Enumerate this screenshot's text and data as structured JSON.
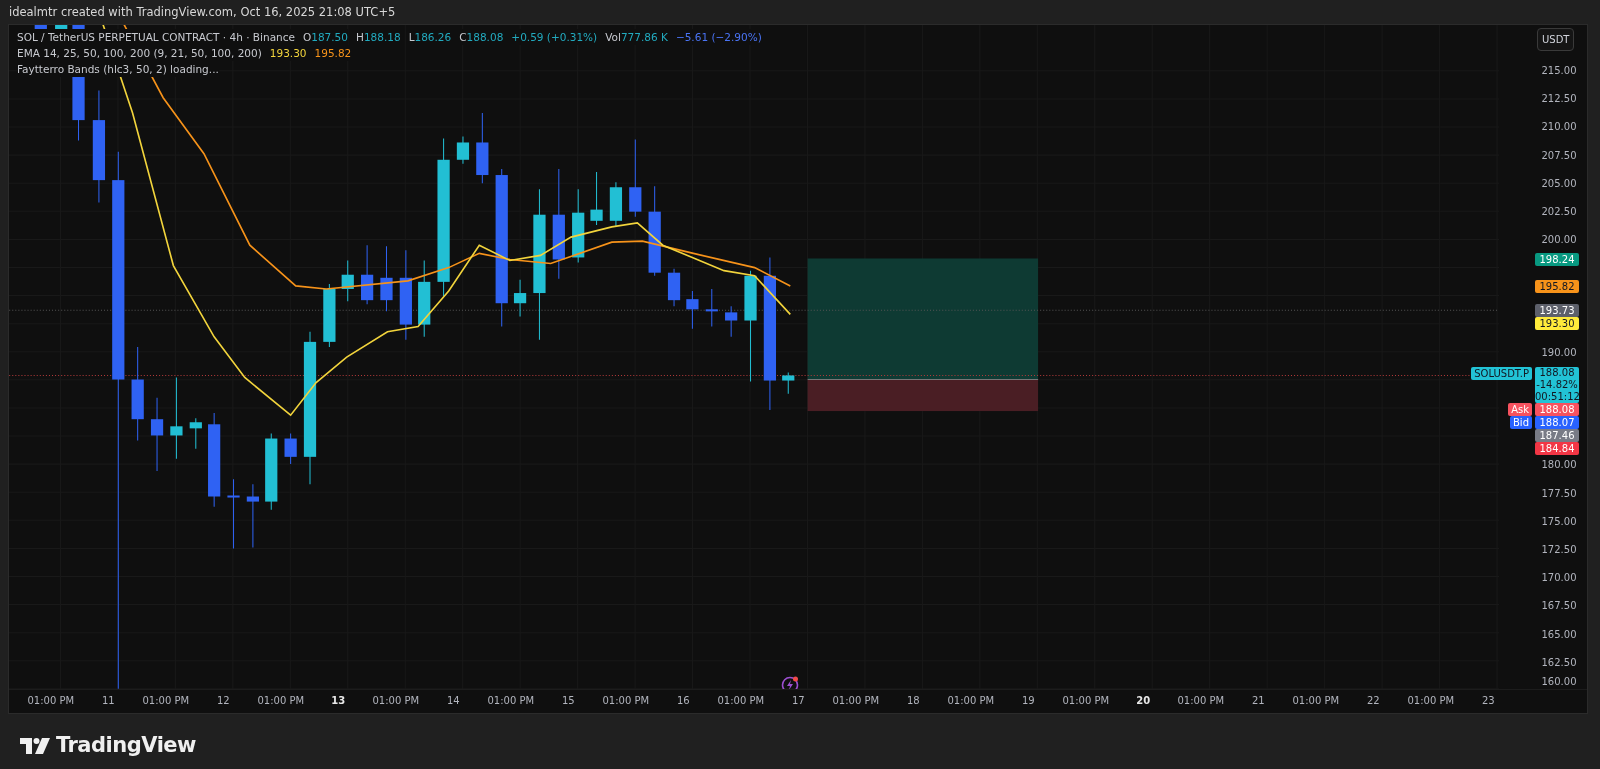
{
  "header": {
    "text": "idealmtr created with TradingView.com, Oct 16, 2025 21:08 UTC+5"
  },
  "legend": {
    "title": "SOL / TetherUS PERPETUAL CONTRACT · 4h · Binance",
    "ohlc": [
      {
        "label": "O",
        "value": "187.50"
      },
      {
        "label": "H",
        "value": "188.18"
      },
      {
        "label": "L",
        "value": "186.26"
      },
      {
        "label": "C",
        "value": "188.08"
      }
    ],
    "change": "+0.59 (+0.31%)",
    "volume": {
      "label": "Vol",
      "value": "777.86 K",
      "change": "−5.61 (−2.90%)"
    },
    "indicators": [
      {
        "name": "EMA 14, 25, 50, 100, 200 (9, 21, 50, 100, 200)",
        "values": [
          {
            "text": "193.30",
            "color": "#f2d43c"
          },
          {
            "text": "195.82",
            "color": "#f7931a"
          }
        ]
      },
      {
        "name": "Faytterro Bands (hlc3, 50, 2) loading..."
      }
    ]
  },
  "price_axis": {
    "currency": "USDT",
    "ticks": [
      "215.00",
      "212.50",
      "210.00",
      "207.50",
      "205.00",
      "202.50",
      "200.00",
      "190.00",
      "180.00",
      "177.50",
      "175.00",
      "172.50",
      "170.00",
      "167.50",
      "165.00",
      "162.50",
      "160.00"
    ],
    "tags": [
      {
        "kind": "price",
        "text": "198.24",
        "color": "#089981"
      },
      {
        "kind": "price",
        "text": "195.82",
        "color": "#f7931a"
      },
      {
        "kind": "price",
        "text": "193.73",
        "color": "#5d606b"
      },
      {
        "kind": "price",
        "text": "193.30",
        "color": "#ffeb3b"
      },
      {
        "kind": "last",
        "symbol": "SOLUSDT.P",
        "text": "188.08",
        "change": "-14.82%",
        "countdown": "00:51:12",
        "color": "#22c3d6"
      },
      {
        "kind": "quote",
        "label": "Ask",
        "text": "188.08",
        "color": "#f7525f"
      },
      {
        "kind": "quote",
        "label": "Bid",
        "text": "188.07",
        "color": "#2962ff"
      },
      {
        "kind": "price",
        "text": "187.46",
        "color": "#787b86"
      },
      {
        "kind": "price",
        "text": "184.84",
        "color": "#f23645"
      }
    ]
  },
  "time_axis": [
    {
      "text": "01:00 PM",
      "emphasis": false
    },
    {
      "text": "11",
      "emphasis": false
    },
    {
      "text": "01:00 PM",
      "emphasis": false
    },
    {
      "text": "12",
      "emphasis": false
    },
    {
      "text": "01:00 PM",
      "emphasis": false
    },
    {
      "text": "13",
      "emphasis": true
    },
    {
      "text": "01:00 PM",
      "emphasis": false
    },
    {
      "text": "14",
      "emphasis": false
    },
    {
      "text": "01:00 PM",
      "emphasis": false
    },
    {
      "text": "15",
      "emphasis": false
    },
    {
      "text": "01:00 PM",
      "emphasis": false
    },
    {
      "text": "16",
      "emphasis": false
    },
    {
      "text": "01:00 PM",
      "emphasis": false
    },
    {
      "text": "17",
      "emphasis": false
    },
    {
      "text": "01:00 PM",
      "emphasis": false
    },
    {
      "text": "18",
      "emphasis": false
    },
    {
      "text": "01:00 PM",
      "emphasis": false
    },
    {
      "text": "19",
      "emphasis": false
    },
    {
      "text": "01:00 PM",
      "emphasis": false
    },
    {
      "text": "20",
      "emphasis": true
    },
    {
      "text": "01:00 PM",
      "emphasis": false
    },
    {
      "text": "21",
      "emphasis": false
    },
    {
      "text": "01:00 PM",
      "emphasis": false
    },
    {
      "text": "22",
      "emphasis": false
    },
    {
      "text": "01:00 PM",
      "emphasis": false
    },
    {
      "text": "23",
      "emphasis": false
    }
  ],
  "footer": {
    "brand": "TradingView"
  }
}
